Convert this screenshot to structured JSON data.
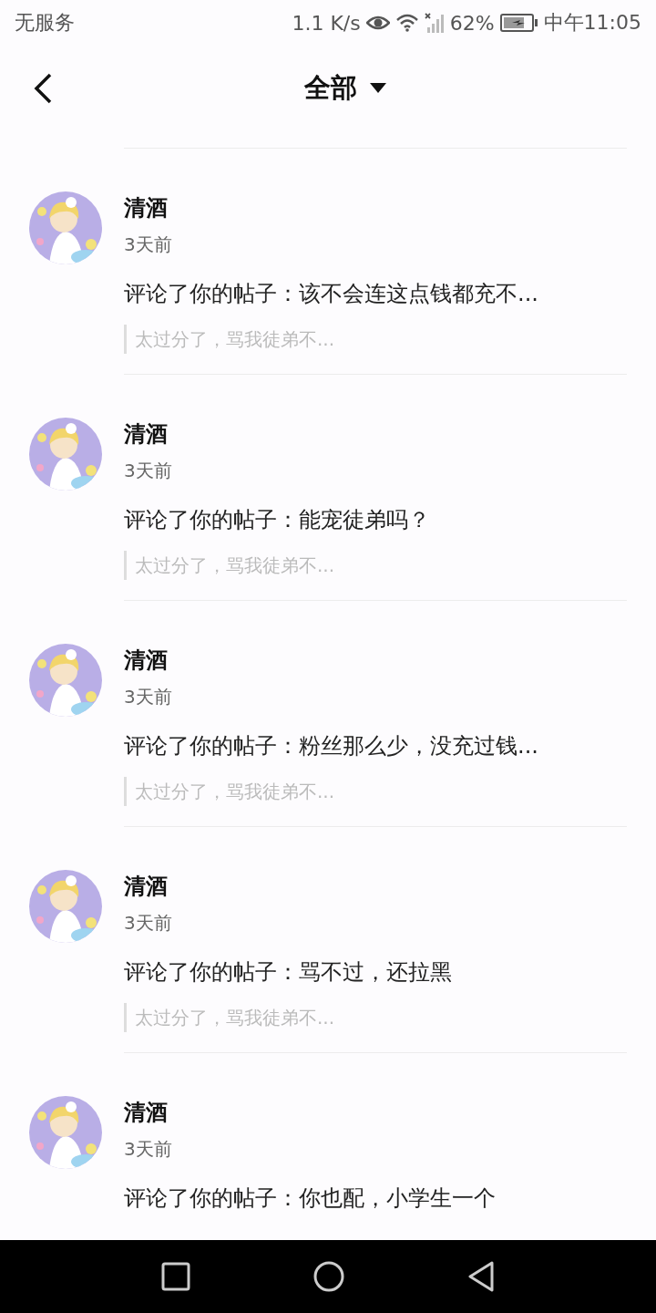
{
  "status_bar": {
    "carrier": "无服务",
    "speed": "1.1 K/s",
    "battery": "62%",
    "time": "中午11:05"
  },
  "header": {
    "title": "全部"
  },
  "notifications": [
    {
      "user": "清酒",
      "time": "3天前",
      "comment": "评论了你的帖子：该不会连这点钱都充不...",
      "quote": "太过分了，骂我徒弟不..."
    },
    {
      "user": "清酒",
      "time": "3天前",
      "comment": "评论了你的帖子：能宠徒弟吗？",
      "quote": "太过分了，骂我徒弟不..."
    },
    {
      "user": "清酒",
      "time": "3天前",
      "comment": "评论了你的帖子：粉丝那么少，没充过钱...",
      "quote": "太过分了，骂我徒弟不..."
    },
    {
      "user": "清酒",
      "time": "3天前",
      "comment": "评论了你的帖子：骂不过，还拉黑",
      "quote": "太过分了，骂我徒弟不..."
    },
    {
      "user": "清酒",
      "time": "3天前",
      "comment": "评论了你的帖子：你也配，小学生一个"
    }
  ]
}
